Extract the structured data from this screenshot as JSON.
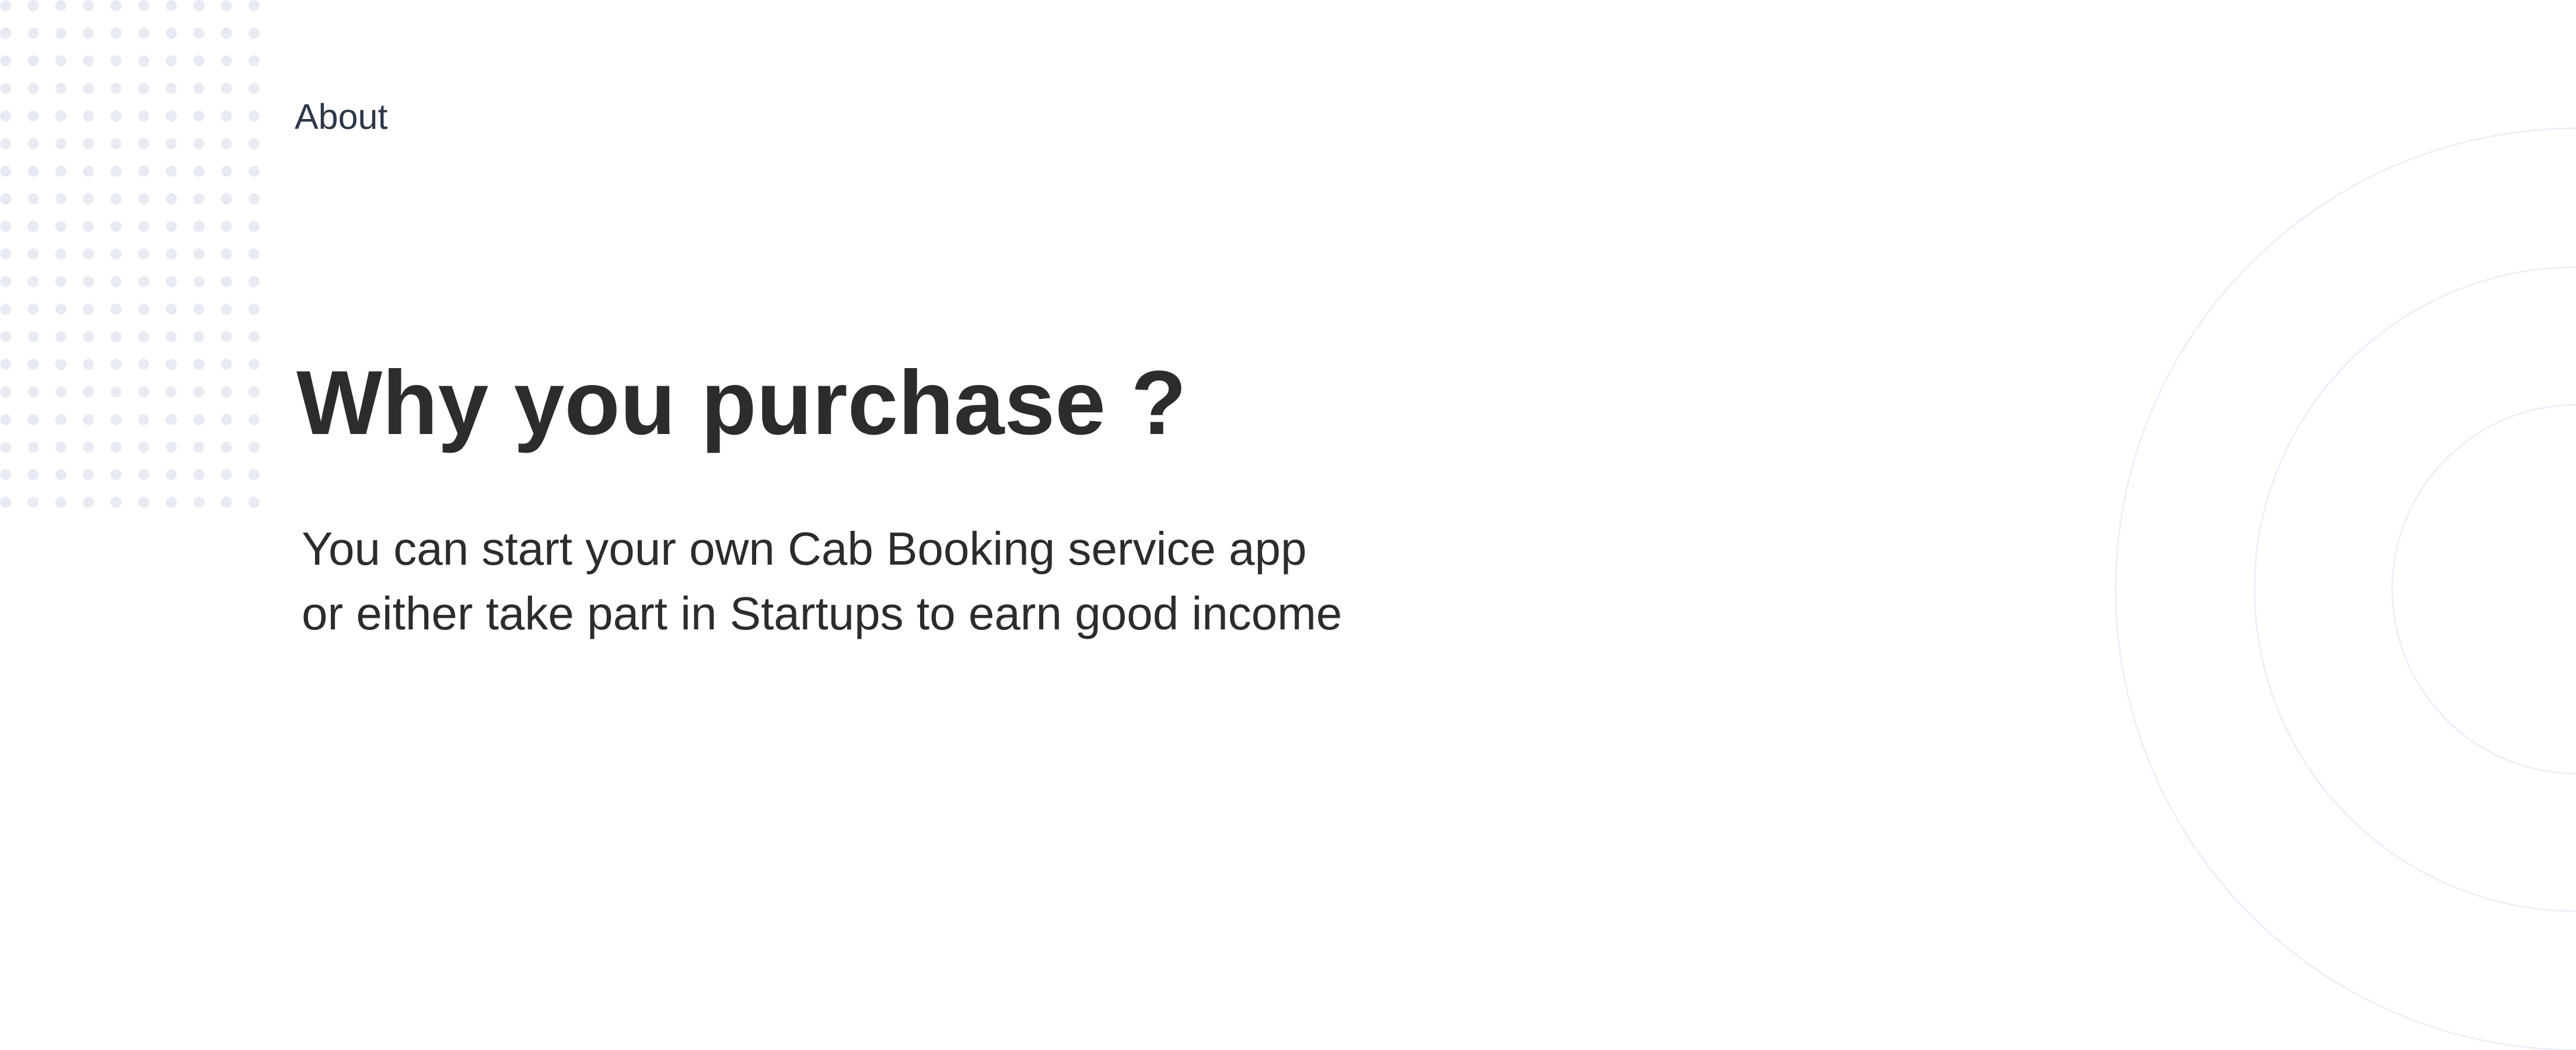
{
  "section": {
    "label": "About"
  },
  "hero": {
    "heading": "Why you purchase ?",
    "description_lines": [
      "You can start your own Cab Booking service app",
      "or either take part in Startups to earn good income"
    ]
  },
  "decorations": {
    "dot_grid_icon": "dot-grid-pattern",
    "rings_icon": "concentric-rings",
    "dot_grid": {
      "columns": 10,
      "rows": 19
    },
    "ring_count": 3
  },
  "colors": {
    "background": "#ffffff",
    "label": "#2d3748",
    "heading": "#2b2c2e",
    "body_text": "#2b2c2e",
    "dots": "#e8ebf3",
    "rings": "#eceff9"
  }
}
